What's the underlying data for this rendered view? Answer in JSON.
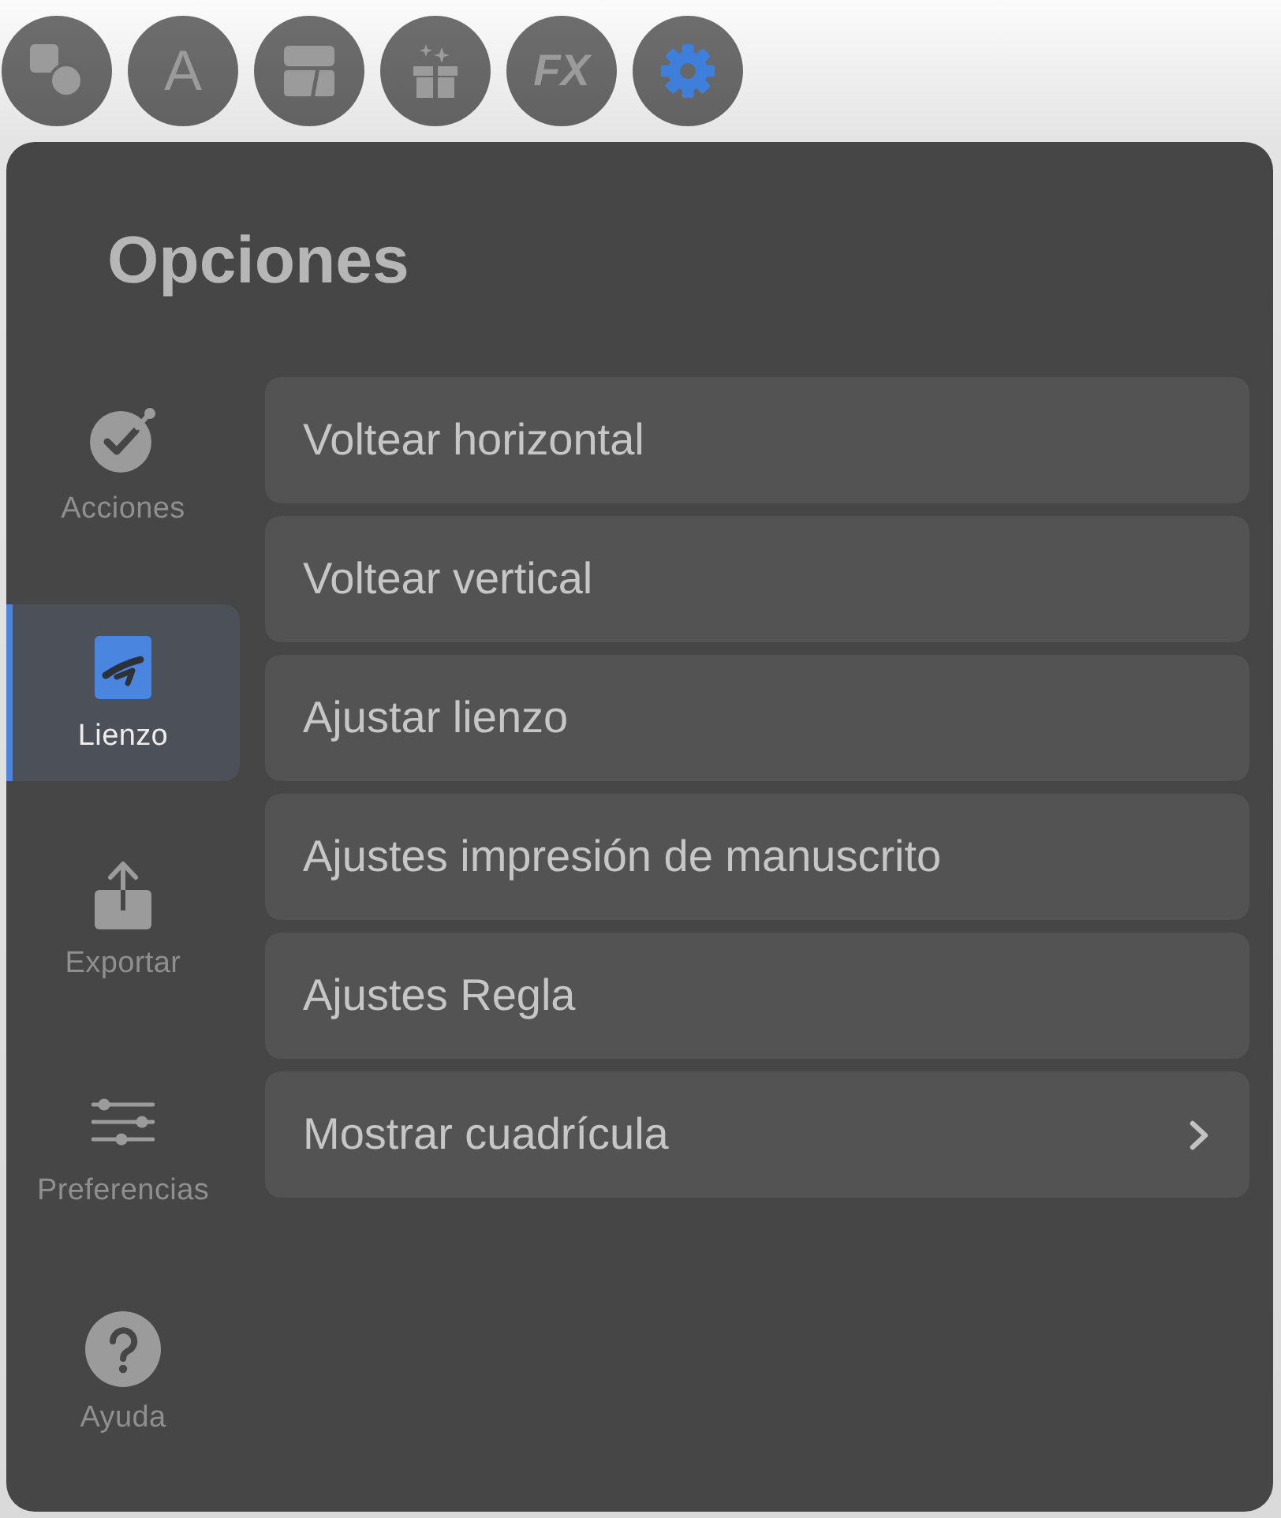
{
  "toolbar": [
    {
      "kind": "shapes",
      "selected": false
    },
    {
      "kind": "letter",
      "label": "A",
      "selected": false
    },
    {
      "kind": "layout",
      "selected": false
    },
    {
      "kind": "gift",
      "selected": false
    },
    {
      "kind": "fx",
      "label": "FX",
      "selected": false
    },
    {
      "kind": "gear",
      "selected": true
    }
  ],
  "panel": {
    "title": "Opciones"
  },
  "sidebar": {
    "items": [
      {
        "kind": "actions",
        "label": "Acciones",
        "selected": false
      },
      {
        "kind": "canvas",
        "label": "Lienzo",
        "selected": true
      },
      {
        "kind": "export",
        "label": "Exportar",
        "selected": false
      },
      {
        "kind": "preferences",
        "label": "Preferencias",
        "selected": false
      },
      {
        "kind": "help",
        "label": "Ayuda",
        "selected": false
      }
    ]
  },
  "menu": {
    "items": [
      {
        "kind": "action",
        "label": "Voltear horizontal"
      },
      {
        "kind": "action",
        "label": "Voltear vertical"
      },
      {
        "kind": "action",
        "label": "Ajustar lienzo"
      },
      {
        "kind": "action",
        "label": "Ajustes impresión de manuscrito"
      },
      {
        "kind": "action",
        "label": "Ajustes Regla"
      },
      {
        "kind": "submenu",
        "label": "Mostrar cuadrícula"
      }
    ]
  }
}
